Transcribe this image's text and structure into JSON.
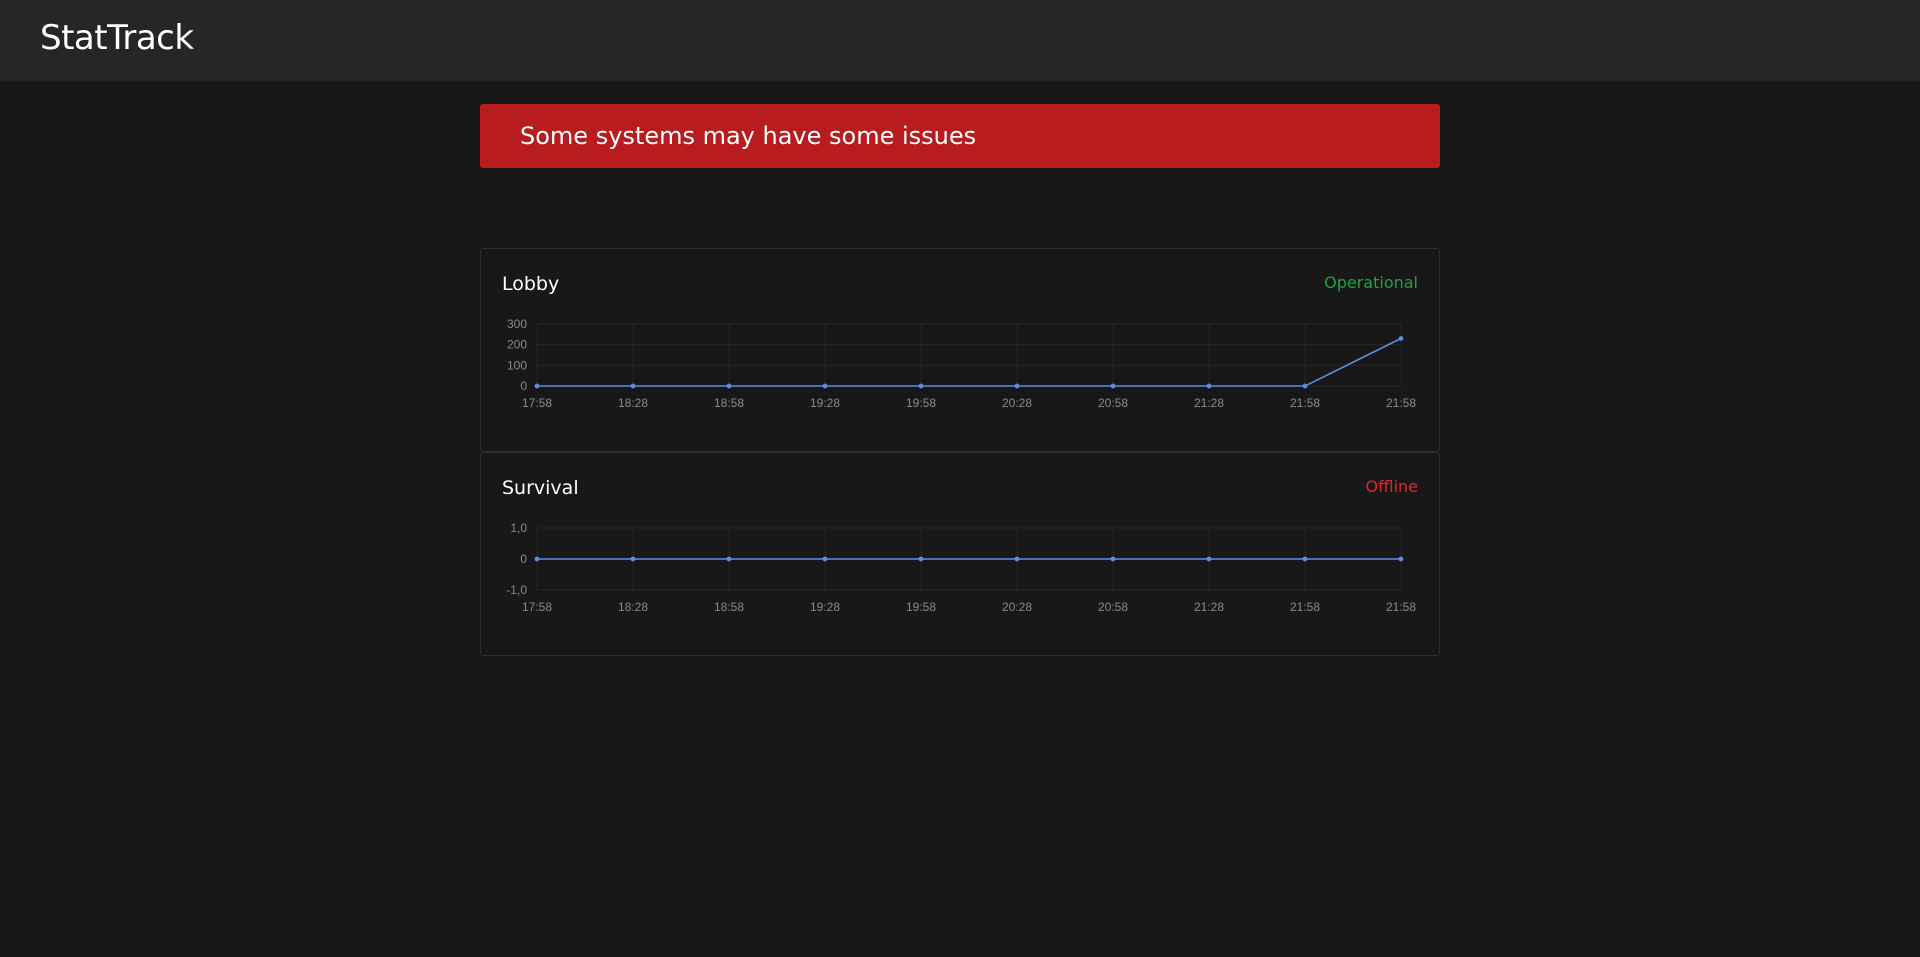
{
  "app": {
    "title": "StatTrack"
  },
  "alert": {
    "message": "Some systems may have some issues",
    "color": "#b91c1e"
  },
  "colors": {
    "operational": "#22a33e",
    "offline": "#e3242b",
    "line": "#5b8ee6",
    "grid": "#262626"
  },
  "servers": [
    {
      "name": "Lobby",
      "status": "Operational",
      "status_key": "operational",
      "chart_data": {
        "type": "line",
        "x": [
          "17:58",
          "18:28",
          "18:58",
          "19:28",
          "19:58",
          "20:28",
          "20:58",
          "21:28",
          "21:58",
          "21:58"
        ],
        "values": [
          0,
          0,
          0,
          0,
          0,
          0,
          0,
          0,
          0,
          230
        ],
        "ylim": [
          0,
          300
        ],
        "yticks": [
          0,
          100,
          200,
          300
        ],
        "ytick_labels": [
          "0",
          "100",
          "200",
          "300"
        ],
        "grid": true,
        "legend": "none"
      }
    },
    {
      "name": "Survival",
      "status": "Offline",
      "status_key": "offline",
      "chart_data": {
        "type": "line",
        "x": [
          "17:58",
          "18:28",
          "18:58",
          "19:28",
          "19:58",
          "20:28",
          "20:58",
          "21:28",
          "21:58",
          "21:58"
        ],
        "values": [
          0,
          0,
          0,
          0,
          0,
          0,
          0,
          0,
          0,
          0
        ],
        "ylim": [
          -1,
          1
        ],
        "yticks": [
          -1,
          0,
          1
        ],
        "ytick_labels": [
          "-1,0",
          "0",
          "1,0"
        ],
        "grid": true,
        "legend": "none"
      }
    }
  ]
}
